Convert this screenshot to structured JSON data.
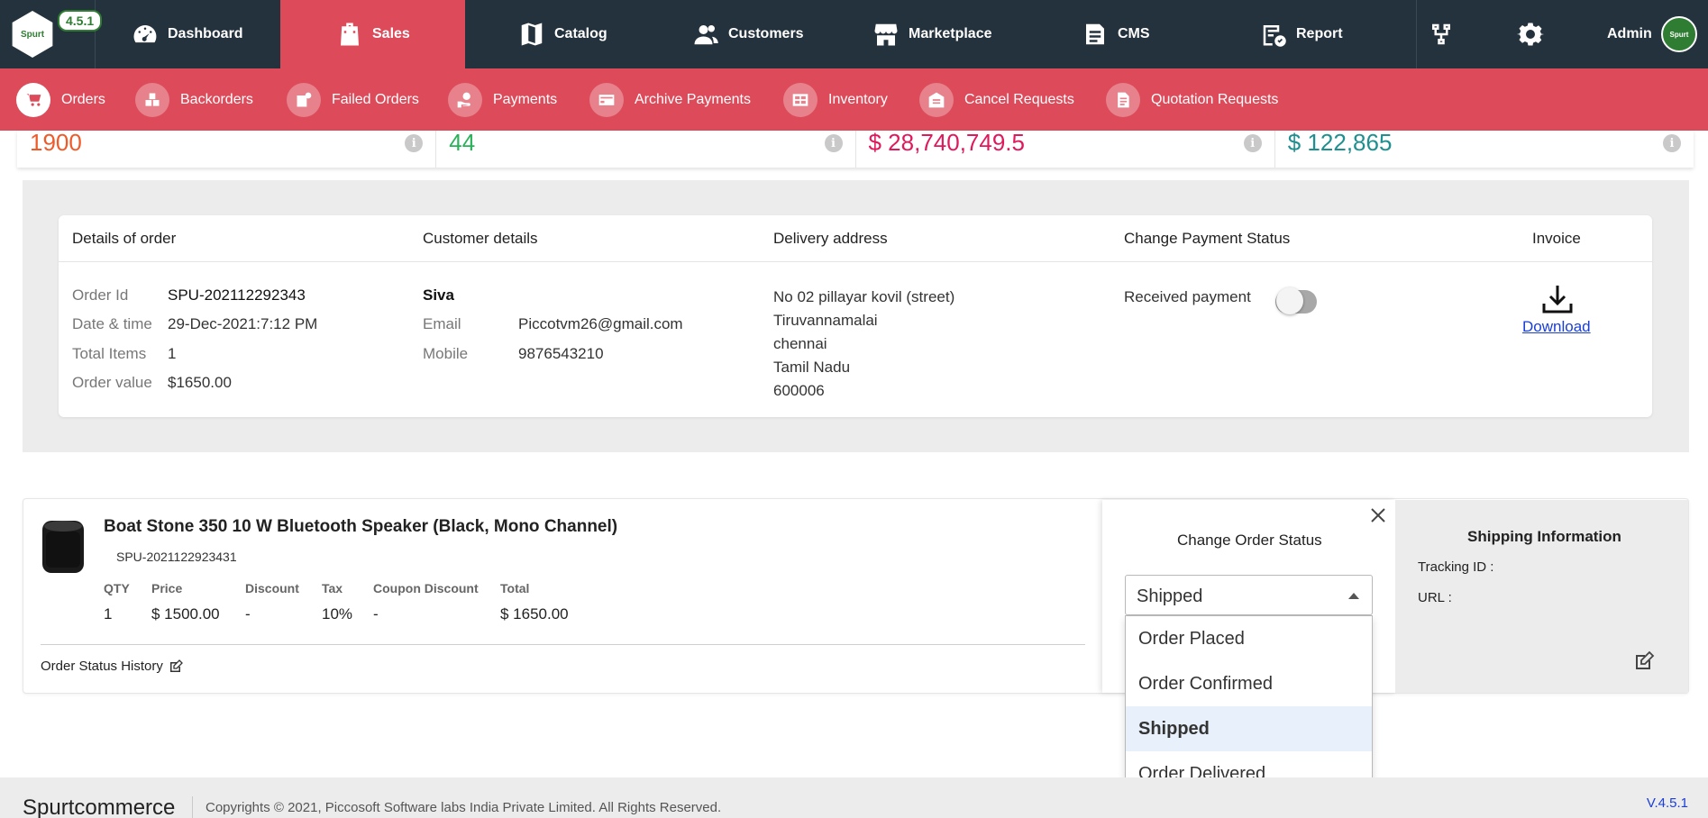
{
  "app": {
    "logo_text": "Spurt",
    "version_badge": "4.5.1",
    "admin_label": "Admin",
    "avatar_text": "Spurt"
  },
  "topnav": {
    "items": [
      {
        "label": "Dashboard",
        "icon": "speedometer-icon"
      },
      {
        "label": "Sales",
        "icon": "shopping-bag-icon",
        "active": true
      },
      {
        "label": "Catalog",
        "icon": "map-book-icon"
      },
      {
        "label": "Customers",
        "icon": "users-icon"
      },
      {
        "label": "Marketplace",
        "icon": "store-icon"
      },
      {
        "label": "CMS",
        "icon": "cms-icon"
      },
      {
        "label": "Report",
        "icon": "report-icon"
      }
    ]
  },
  "subnav": {
    "items": [
      {
        "label": "Orders",
        "active": true
      },
      {
        "label": "Backorders"
      },
      {
        "label": "Failed Orders"
      },
      {
        "label": "Payments"
      },
      {
        "label": "Archive Payments"
      },
      {
        "label": "Inventory"
      },
      {
        "label": "Cancel Requests"
      },
      {
        "label": "Quotation Requests"
      }
    ]
  },
  "stats": [
    {
      "value": "1900",
      "color": "#ef5a2a"
    },
    {
      "value": "44",
      "color": "#2ab25a"
    },
    {
      "value": "$ 28,740,749.5",
      "color": "#e0195b"
    },
    {
      "value": "$ 122,865",
      "color": "#1f8f8f"
    }
  ],
  "order": {
    "headers": {
      "details": "Details of order",
      "customer": "Customer details",
      "delivery": "Delivery address",
      "payment": "Change Payment Status",
      "invoice": "Invoice"
    },
    "details": {
      "order_id_label": "Order Id",
      "order_id": "SPU-202112292343",
      "datetime_label": "Date & time",
      "datetime": "29-Dec-2021:7:12 PM",
      "items_label": "Total Items",
      "items": "1",
      "value_label": "Order value",
      "value": "$1650.00"
    },
    "customer": {
      "name": "Siva",
      "email_label": "Email",
      "email": "Piccotvm26@gmail.com",
      "mobile_label": "Mobile",
      "mobile": "9876543210"
    },
    "delivery": {
      "line1": "No 02 pillayar kovil (street)",
      "line2": "Tiruvannamalai",
      "line3": "chennai",
      "line4": "Tamil Nadu",
      "line5": "600006"
    },
    "payment": {
      "label": "Received payment",
      "received": false
    },
    "invoice": {
      "download_label": "Download"
    }
  },
  "product": {
    "title": "Boat Stone 350 10 W Bluetooth Speaker (Black, Mono Channel)",
    "sku": "SPU-2021122923431",
    "columns": [
      "QTY",
      "Price",
      "Discount",
      "Tax",
      "Coupon Discount",
      "Total"
    ],
    "values": [
      "1",
      "$ 1500.00",
      "-",
      "10%",
      "-",
      "$ 1650.00"
    ],
    "history_label": "Order Status History"
  },
  "status_panel": {
    "title": "Change Order Status",
    "selected": "Shipped",
    "options": [
      "Order Placed",
      "Order Confirmed",
      "Shipped",
      "Order Delivered"
    ]
  },
  "shipping": {
    "title": "Shipping Information",
    "tracking_label": "Tracking ID :",
    "url_label": "URL :"
  },
  "footer": {
    "brand": "Spurtcommerce",
    "copyright": "Copyrights © 2021, Piccosoft Software labs India Private Limited. All Rights Reserved.",
    "version": "V.4.5.1"
  }
}
